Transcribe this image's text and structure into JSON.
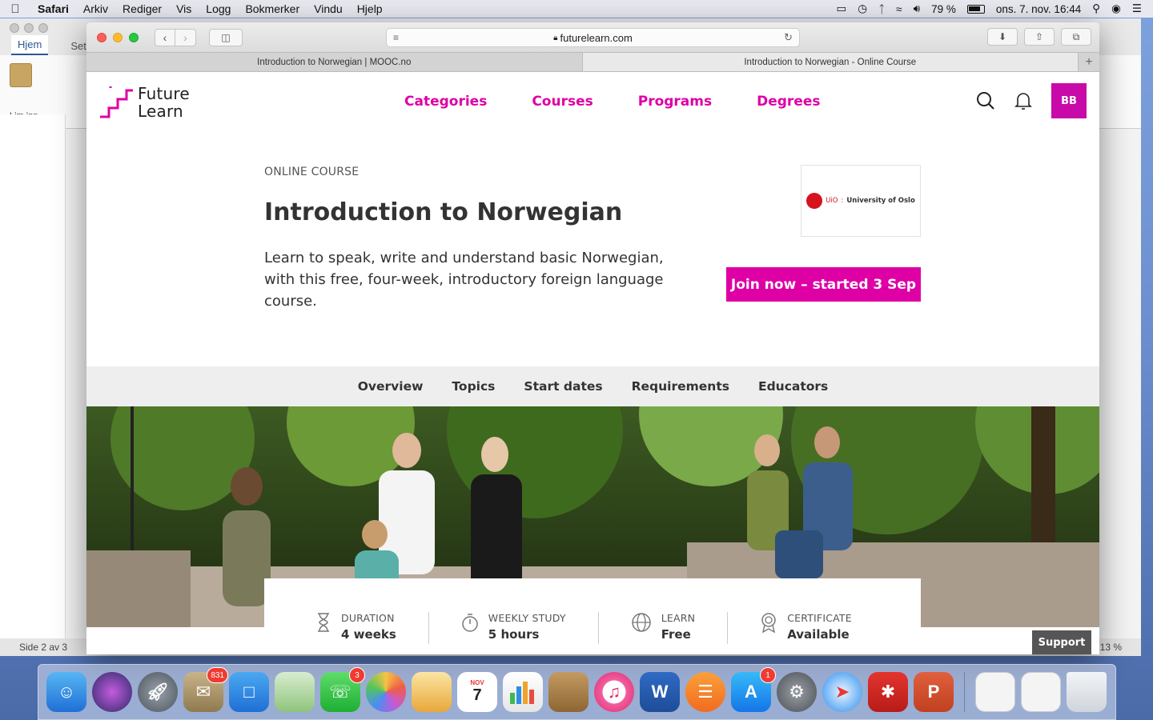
{
  "menubar": {
    "app": "Safari",
    "items": [
      "Arkiv",
      "Rediger",
      "Vis",
      "Logg",
      "Bokmerker",
      "Vindu",
      "Hjelp"
    ],
    "battery": "79 %",
    "datetime": "ons. 7. nov.  16:44"
  },
  "word": {
    "tabs": [
      "Hjem",
      "Sett"
    ],
    "paste_label": "Lim inn",
    "status": "Side 2 av 3",
    "zoom": "13 %"
  },
  "safari": {
    "url": "futurelearn.com",
    "tabs": [
      {
        "title": "Introduction to Norwegian | MOOC.no"
      },
      {
        "title": "Introduction to Norwegian - Online Course"
      }
    ]
  },
  "site": {
    "logo_line1": "Future",
    "logo_line2": "Learn",
    "nav": [
      "Categories",
      "Courses",
      "Programs",
      "Degrees"
    ],
    "avatar": "BB",
    "accent": "#de00a5"
  },
  "course": {
    "type": "ONLINE COURSE",
    "title": "Introduction to Norwegian",
    "description": "Learn to speak, write and understand basic Norwegian, with this free, four-week, introductory foreign language course.",
    "university_short": "UiO",
    "university": "University of Oslo",
    "join_label": "Join now – started 3 Sep",
    "subnav": [
      "Overview",
      "Topics",
      "Start dates",
      "Requirements",
      "Educators"
    ],
    "info": [
      {
        "icon": "hourglass-icon",
        "label": "DURATION",
        "value": "4 weeks"
      },
      {
        "icon": "stopwatch-icon",
        "label": "WEEKLY STUDY",
        "value": "5 hours"
      },
      {
        "icon": "globe-icon",
        "label": "LEARN",
        "value": "Free"
      },
      {
        "icon": "certificate-icon",
        "label": "CERTIFICATE",
        "value": "Available"
      }
    ],
    "support_label": "Support"
  },
  "dock": {
    "badges": {
      "mail": "831",
      "facetime": "3",
      "appstore": "1"
    },
    "calendar_month": "NOV",
    "calendar_day": "7",
    "word_letter": "W",
    "powerpoint_letter": "P"
  }
}
